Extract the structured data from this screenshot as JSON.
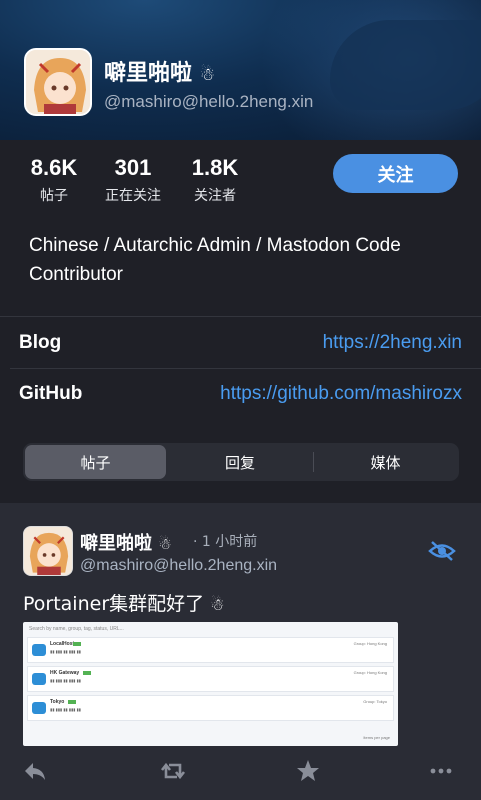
{
  "profile": {
    "display_name": "噼里啪啦",
    "handle": "@mashiro@hello.2heng.xin",
    "stats": [
      {
        "value": "8.6K",
        "label": "帖子"
      },
      {
        "value": "301",
        "label": "正在关注"
      },
      {
        "value": "1.8K",
        "label": "关注者"
      }
    ],
    "follow_label": "关注",
    "bio": "Chinese / Autarchic Admin / Mastodon Code Contributor",
    "fields": [
      {
        "name": "Blog",
        "value": "https://2heng.xin"
      },
      {
        "name": "GitHub",
        "value": "https://github.com/mashirozx"
      }
    ]
  },
  "tabs": [
    "帖子",
    "回复",
    "媒体"
  ],
  "active_tab": "帖子",
  "post": {
    "author": "噼里啪啦",
    "time": "· 1 小时前",
    "handle": "@mashiro@hello.2heng.xin",
    "text": "Portainer集群配好了",
    "attachment": {
      "search_placeholder": "Search by name, group, tag, status, URL...",
      "clusters": [
        {
          "name": "LocalHost",
          "group": "Group: Hong Kong"
        },
        {
          "name": "HK Gateway",
          "group": "Group: Hong Kong"
        },
        {
          "name": "Tokyo",
          "group": "Group: Tokyo"
        }
      ],
      "footer": "Items per page"
    }
  },
  "colors": {
    "accent": "#4a90e2",
    "link": "#4a9cf0",
    "background": "#1f2027",
    "feed_background": "#2a2c35"
  },
  "icons": [
    "reply-icon",
    "boost-icon",
    "favourite-icon",
    "more-icon",
    "visibility-icon"
  ]
}
